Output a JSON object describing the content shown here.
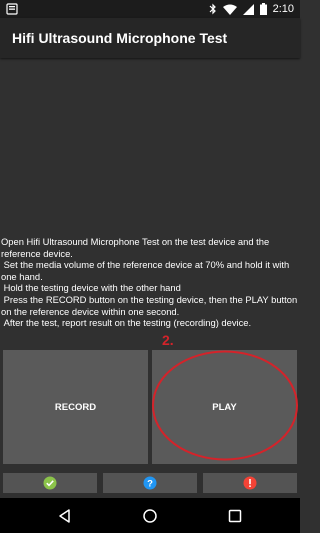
{
  "status_bar": {
    "time": "2:10",
    "icons": [
      "notification-icon",
      "bluetooth-icon",
      "wifi-icon",
      "signal-icon",
      "battery-icon"
    ]
  },
  "app_bar": {
    "title": "Hifi Ultrasound Microphone Test"
  },
  "instructions": {
    "text": "Open Hifi Ultrasound Microphone Test on the test device and the reference device.\n Set the media volume of the reference device at 70% and hold it with one hand.\n Hold the testing device with the other hand\n Press the RECORD button on the testing device, then the PLAY button on the reference device within one second.\n After the test, report result on the testing (recording) device."
  },
  "annotation": {
    "label": "2.",
    "color": "#d4232a"
  },
  "buttons": {
    "record_label": "RECORD",
    "play_label": "PLAY"
  },
  "result_buttons": {
    "pass": {
      "icon": "check-icon",
      "color": "#8bc34a"
    },
    "info": {
      "icon": "question-icon",
      "color": "#2196f3"
    },
    "fail": {
      "icon": "alert-icon",
      "color": "#f44336"
    }
  },
  "nav_bar": {
    "icons": [
      "back-icon",
      "home-icon",
      "recents-icon"
    ]
  }
}
